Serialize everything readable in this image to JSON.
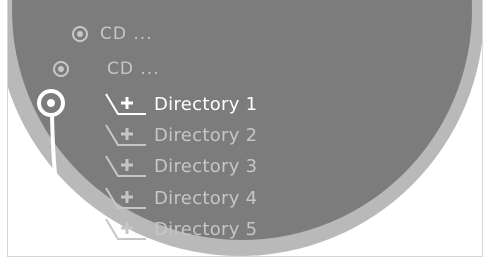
{
  "menu": {
    "items": [
      {
        "label": "CD ...",
        "icon": "cd-icon"
      },
      {
        "label": "CD ...",
        "icon": "cd-icon"
      },
      {
        "label": "Directory 1",
        "icon": "directory-add-icon",
        "highlighted": true
      },
      {
        "label": "Directory 2",
        "icon": "directory-add-icon"
      },
      {
        "label": "Directory 3",
        "icon": "directory-add-icon"
      },
      {
        "label": "Directory 4",
        "icon": "directory-add-icon"
      },
      {
        "label": "Directory 5",
        "icon": "directory-add-icon"
      }
    ]
  },
  "colors": {
    "dial_fill": "#7c7c7c",
    "dial_rim": "#b9b9b9",
    "text_selected": "#ffffff",
    "text_normal": "#c6c6c6"
  }
}
